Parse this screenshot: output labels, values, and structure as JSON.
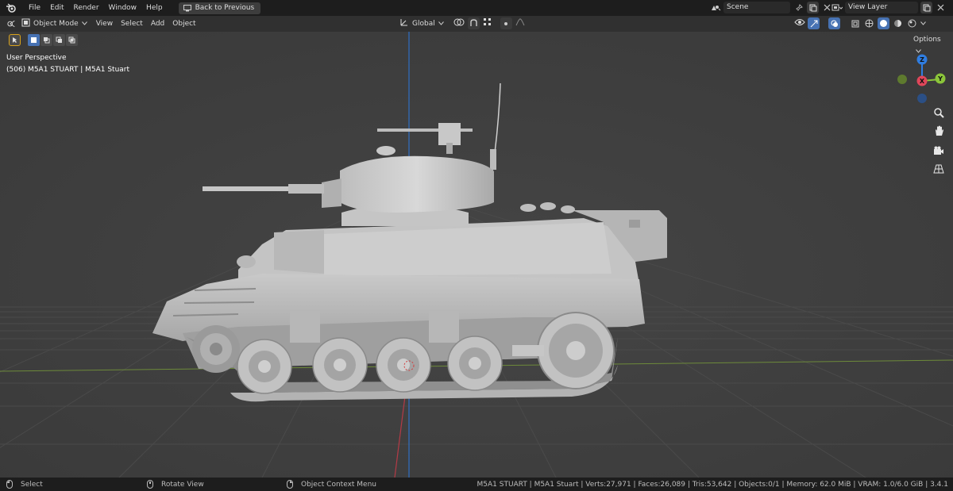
{
  "menubar": {
    "items": [
      "File",
      "Edit",
      "Render",
      "Window",
      "Help"
    ],
    "back_button": "Back to Previous",
    "scene": "Scene",
    "view_layer": "View Layer"
  },
  "viewport_header": {
    "mode": "Object Mode",
    "menus": [
      "View",
      "Select",
      "Add",
      "Object"
    ],
    "transform_orientation": "Global",
    "options": "Options"
  },
  "overlay": {
    "view_name": "User Perspective",
    "object_info": "(506) M5A1 STUART | M5A1 Stuart"
  },
  "gizmo": {
    "z": "Z",
    "x": "X",
    "y": "Y"
  },
  "colors": {
    "accent": "#4772b3",
    "x_axis": "#e0465a",
    "y_axis": "#8bc53a",
    "z_axis": "#2f7de1",
    "active_tool": "#d9a21b"
  },
  "statusbar": {
    "select": "Select",
    "rotate": "Rotate View",
    "context": "Object Context Menu",
    "stats": "M5A1 STUART | M5A1 Stuart | Verts:27,971 | Faces:26,089 | Tris:53,642 | Objects:0/1 | Memory: 62.0 MiB | VRAM: 1.0/6.0 GiB | 3.4.1"
  }
}
